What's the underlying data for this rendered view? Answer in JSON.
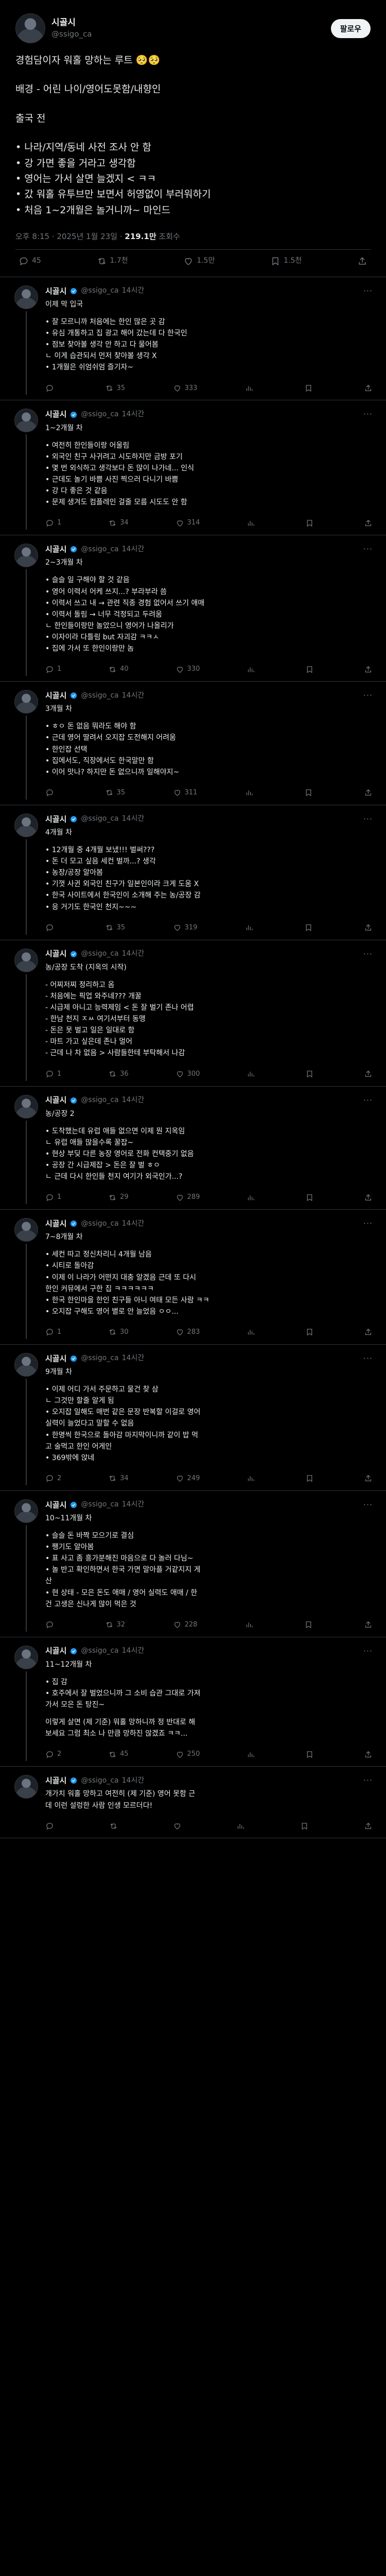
{
  "author": {
    "display_name": "시골시",
    "handle": "@ssigo_ca",
    "follow_label": "팔로우"
  },
  "main_post": {
    "paragraphs": [
      [
        "경험담이자 워홀 망하는 루트 🥺🥺"
      ],
      [
        "배경 - 어린 나이/영어도못함/내향인"
      ],
      [
        "출국 전"
      ],
      [
        "• 나라/지역/동네 사전 조사 안 함",
        "• 강 가면 좋을 거라고 생각함",
        "• 영어는 가서 살면 늘겠지 < ㅋㅋ",
        "• 갔 워홀 유투브만 보면서 허영없이 부러워하기",
        "• 처음 1~2개월은 놀거니까~ 마인드"
      ]
    ],
    "meta": {
      "time_date": "오후 8:15 · 2025년 1월 23일 · ",
      "views": "219.1만",
      "views_suffix": " 조회수"
    },
    "actions": {
      "replies": "45",
      "reposts": "1.7천",
      "likes": "1.5만",
      "bookmarks": "1.5천"
    }
  },
  "replies": [
    {
      "time": "14시간",
      "paragraphs": [
        [
          "이제 막 입국"
        ],
        [
          "• 잘 모르니까 처음에는 한인 많은 곳 감",
          "• 유심 개통하고 집 광고 해어 갔는데 다 한국인",
          "• 점보 찾아볼 생각 안 하고 다 물어봄",
          "  ㄴ 이게 습관되서 먼저 찾아볼 생각 X",
          "• 1개월은 쉬엄쉬엄 즐기자~"
        ]
      ],
      "actions": {
        "replies": "",
        "reposts": "35",
        "likes": "333",
        "views": "",
        "bookmarks": ""
      }
    },
    {
      "time": "14시간",
      "paragraphs": [
        [
          "1~2개월 차"
        ],
        [
          "• 여전히 한인들이랑 어울림",
          "• 외국인 친구 사귀려고 시도하지만 금방 포기",
          "• 몇 번 외식하고 생각보다 돈 많이 나가네... 인식",
          "• 근데도 놀기 바쁨 사진 찍으러 다니기 바쁨",
          "• 강 다 좋은 것 같음",
          "• 문제 생겨도 컴플레인 걸줄 모름 시도도 안 함"
        ]
      ],
      "actions": {
        "replies": "1",
        "reposts": "34",
        "likes": "314",
        "views": "",
        "bookmarks": ""
      }
    },
    {
      "time": "14시간",
      "paragraphs": [
        [
          "2~3개월 차"
        ],
        [
          "• 슬슬 일 구해야 할 것 같음",
          "• 영어 이력서 어케 쓰지...? 부라부라 씀",
          "• 이력서 쓰고 내 → 관련 직종 경험 없어서 쓰기 애매",
          "• 이력서 돌림 → 너무 걱정되고 두려움",
          "  ㄴ 한인들이랑만 놀았으니 영어가 나올리가",
          "• 이자이라 다틀림 but 자괴감 ㅋㅋㅅ",
          "• 집에 가서 또 한인이랑만 놈"
        ]
      ],
      "actions": {
        "replies": "1",
        "reposts": "40",
        "likes": "330",
        "views": "",
        "bookmarks": ""
      }
    },
    {
      "time": "14시간",
      "paragraphs": [
        [
          "3개월 차"
        ],
        [
          "• ㅎㅇ 돈 없음 뭐라도 해야 함",
          "• 근데 영어 딸려서 오지잡 도전해지 어려움",
          "• 한인잡 선택",
          "• 집에서도, 직장에서도 한국말만 함",
          "• 이어 맛나? 하지만 돈 없으니까 일해야지~"
        ]
      ],
      "actions": {
        "replies": "",
        "reposts": "35",
        "likes": "311",
        "views": "",
        "bookmarks": ""
      }
    },
    {
      "time": "14시간",
      "paragraphs": [
        [
          "4개월 차"
        ],
        [
          "• 12개월 중 4개월 보냈!!! 벌써???",
          "• 돈 더 모고 싶음 세컨 벌까...? 생각",
          "• 농장/공장 알아봄",
          "• 기껏 사귄 외국인 친구가 일본인이라 크게 도움 X",
          "• 한국 사이트에서 한국인이 소개해 주는 농/공장 감",
          "• 응 거기도 한국인 천지~~~"
        ]
      ],
      "actions": {
        "replies": "",
        "reposts": "35",
        "likes": "319",
        "views": "",
        "bookmarks": ""
      }
    },
    {
      "time": "14시간",
      "paragraphs": [
        [
          "농/공장 도착 (지옥의 시작)"
        ],
        [
          "- 어찌저찌 정리하고 옴",
          "- 처음에는 픽업 와주네??? 개꿀",
          "- 시급제 아니고 능력제임 < 돈 잘 벌기 존나 어렵",
          "- 한남 천지 ㅈㅆ 여기서부터 동맹",
          "- 돈은 못 벌고 일은 일대로 함",
          "- 마트 가고 싶은데 존나 멀어",
          "- 근데 나 차 없음 > 사람들한테 부탁해서 나감"
        ]
      ],
      "actions": {
        "replies": "1",
        "reposts": "36",
        "likes": "300",
        "views": "",
        "bookmarks": ""
      }
    },
    {
      "time": "14시간",
      "paragraphs": [
        [
          "농/공장 2"
        ],
        [
          "• 도착했는데 유럽 애들 없으면 이제 뭔 지옥임",
          "  ㄴ 유럽 애들 많을수록 꿀잡~",
          "• 현상 부딪 다른 농장 영어로 전화 컨택중기 없음",
          "• 공장 간 시급제잡 > 돈은 잘 벌 ㅎㅇ",
          "  ㄴ 근데 다시 한인들 천지 여기가 외국인가...?"
        ]
      ],
      "actions": {
        "replies": "1",
        "reposts": "29",
        "likes": "289",
        "views": "",
        "bookmarks": ""
      }
    },
    {
      "time": "14시간",
      "paragraphs": [
        [
          "7~8개월 차"
        ],
        [
          "• 세컨 따고 정신차리니 4개월 남음",
          "• 시티로 돌아감",
          "• 이제 이 나라가 어떤지 대충 알겠음 근데 또 다시",
          "  한인 커뮤에서 구한 집 ㅋㅋㅋㅋㅋㅋ",
          "• 한국 한인마을 한인 친구들 아니 여태 모든 사람 ㅋㅋ",
          "• 오지잡 구해도 영어 별로 안 늘었음 ㅇㅇ..."
        ]
      ],
      "actions": {
        "replies": "1",
        "reposts": "30",
        "likes": "283",
        "views": "",
        "bookmarks": ""
      }
    },
    {
      "time": "14시간",
      "paragraphs": [
        [
          "9개월 차"
        ],
        [
          "• 이제 어디 가서 주문하고 물건 찾 삼",
          "  ㄴ 그것만 할줄 알게 됨",
          "• 오지잡 일해도 매번 같은 문장 반복할 이걸로 영어",
          "  실력이 늘었다고 말할 수 없음",
          "• 한명씩 한국으로 돌아감 마지막이니까 같이 밥 먹",
          "  고 술먹고 한인 어게인",
          "• 369밖에 앉네"
        ]
      ],
      "actions": {
        "replies": "2",
        "reposts": "34",
        "likes": "249",
        "views": "",
        "bookmarks": ""
      }
    },
    {
      "time": "14시간",
      "paragraphs": [
        [
          "10~11개월 차"
        ],
        [
          "• 슬슬 돈 바짝 모으기로 결심",
          "• 쨍기도 알아봄",
          "• 표 사고 좀 흥가분해진 마음으로 다 놀러 다님~",
          "• 놀 반고 확인하면서 한국 가면 말아플 거같지지 게",
          "  산",
          "• 현 상태 - 모은 돈도 애매 / 영어 실력도 애매 / 한",
          "  건 고생은 신나게 많이 먹은 것"
        ]
      ],
      "actions": {
        "replies": "",
        "reposts": "32",
        "likes": "228",
        "views": "",
        "bookmarks": ""
      }
    },
    {
      "time": "14시간",
      "paragraphs": [
        [
          "11~12개월 차"
        ],
        [
          "• 집 감",
          "• 호주에서 잘 벌었으니까 그 소비 습관 그대로 가져",
          "  가서 모은 돈 탕진~"
        ],
        [
          "이렇게 살면 (제 기준) 워홀 망하니까 정 반대로 해",
          "보세요 그럼 최소 나 만큼 망하진 않겠죠 ㅋㅋ..."
        ]
      ],
      "actions": {
        "replies": "2",
        "reposts": "45",
        "likes": "250",
        "views": "",
        "bookmarks": ""
      }
    },
    {
      "time": "14시간",
      "paragraphs": [
        [
          "개가치 워홀 망하고 여전히 (제 기준) 영어 못함 근",
          "데 이런 설렁한 사람 인생 모르더다!"
        ]
      ],
      "actions": {
        "replies": "",
        "reposts": "",
        "likes": "",
        "views": "",
        "bookmarks": ""
      }
    }
  ]
}
